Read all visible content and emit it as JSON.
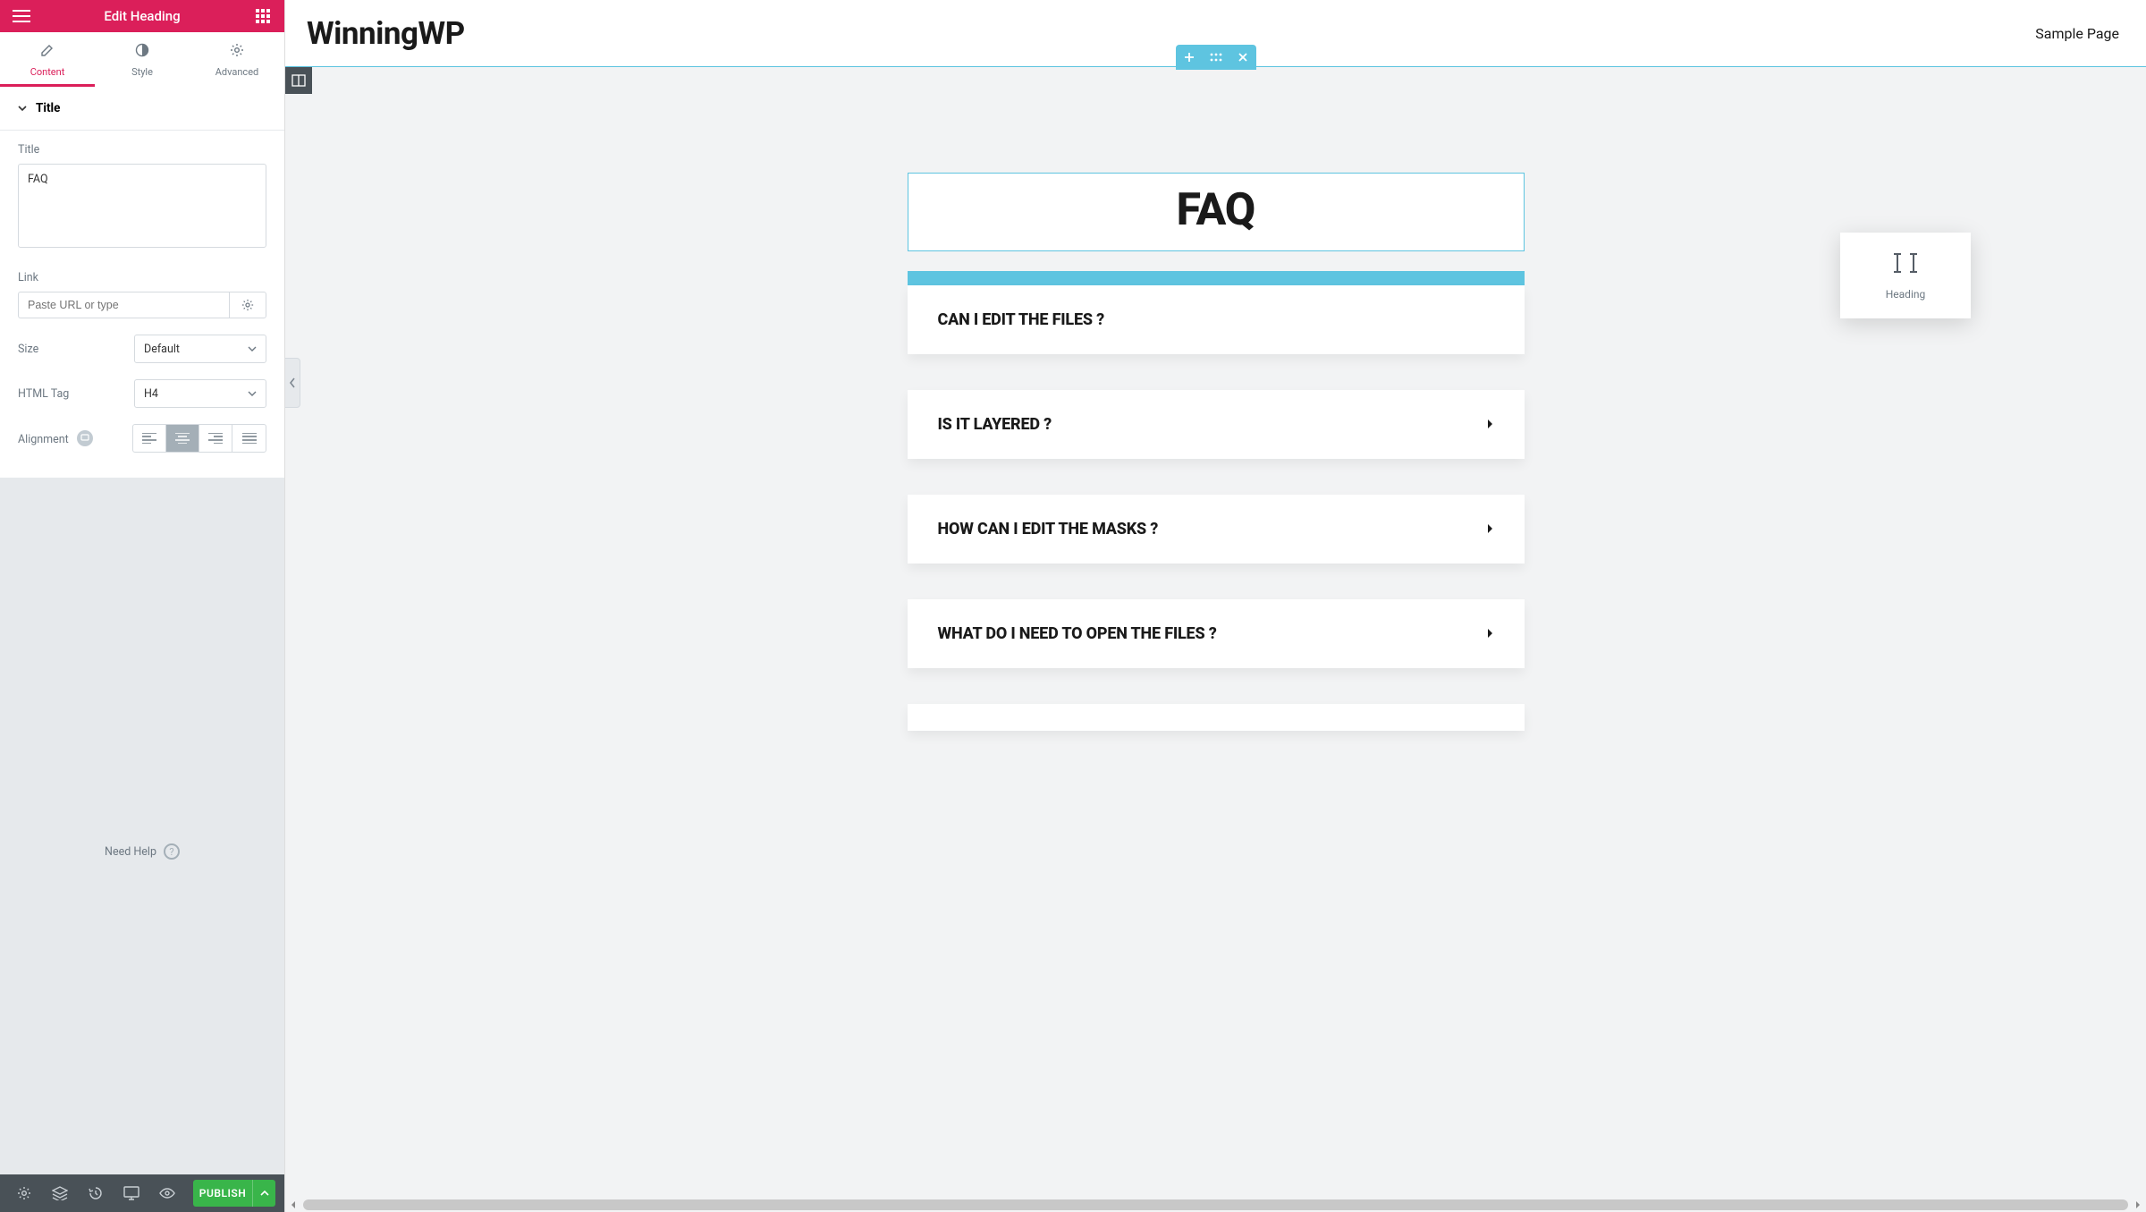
{
  "panel": {
    "header_title": "Edit Heading",
    "tabs": {
      "content": "Content",
      "style": "Style",
      "advanced": "Advanced"
    },
    "section_title": "Title",
    "fields": {
      "title_label": "Title",
      "title_value": "FAQ",
      "link_label": "Link",
      "link_placeholder": "Paste URL or type",
      "size_label": "Size",
      "size_value": "Default",
      "html_tag_label": "HTML Tag",
      "html_tag_value": "H4",
      "alignment_label": "Alignment"
    },
    "need_help": "Need Help",
    "publish": "PUBLISH"
  },
  "preview": {
    "site_title": "WinningWP",
    "nav_link": "Sample Page",
    "heading_text": "FAQ",
    "accordion": [
      "CAN I EDIT THE FILES ?",
      "IS IT LAYERED ?",
      "HOW CAN I EDIT THE MASKS ?",
      "WHAT DO I NEED TO OPEN THE FILES ?"
    ],
    "drag_widget_label": "Heading"
  }
}
